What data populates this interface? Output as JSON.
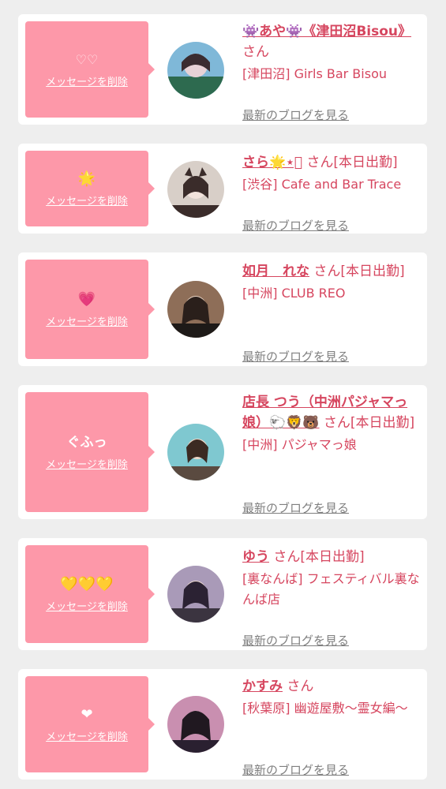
{
  "delete_label": "メッセージを削除",
  "blog_label": "最新のブログを見る",
  "entries": [
    {
      "message": "♡♡",
      "name": "👾あや👾《津田沼Bisou》",
      "san": "さん",
      "status": "",
      "shop": "[津田沼] Girls Bar Bisou",
      "avatar_colors": [
        "#7fb8d8",
        "#e7d2d6",
        "#2d6a4f"
      ]
    },
    {
      "message": "🌟",
      "name": "さら🌟⋆͛",
      "san": "さん",
      "status": "[本日出勤]",
      "shop": "[渋谷] Cafe and Bar Trace",
      "avatar_colors": [
        "#d8cfc8",
        "#f2e3dc",
        "#3a2c2a"
      ]
    },
    {
      "message": "💗",
      "name": "如月　れな",
      "san": "さん",
      "status": "[本日出勤]",
      "shop": "[中洲] CLUB REO",
      "avatar_colors": [
        "#8e6e58",
        "#e8d3c3",
        "#2a1f1b"
      ]
    },
    {
      "message": "ぐふっ",
      "name": "店長 つう（中洲パジャマっ娘）🐑🦁🐻",
      "san": "さん",
      "status": "[本日出勤]",
      "shop": "[中洲] パジャマっ娘",
      "avatar_colors": [
        "#7fc8d0",
        "#f0d7c7",
        "#3b2a22"
      ]
    },
    {
      "message": "💛💛💛",
      "name": "ゆう",
      "san": "さん",
      "status": "[本日出勤]",
      "shop": "[裏なんば] フェスティバル裏なんば店",
      "avatar_colors": [
        "#a99ab8",
        "#f1ddd4",
        "#2b2233"
      ]
    },
    {
      "message": "❤",
      "name": "かすみ",
      "san": "さん",
      "status": "",
      "shop": "[秋葉原] 幽遊屋敷〜霊女編〜",
      "avatar_colors": [
        "#c98fb0",
        "#f3e0e3",
        "#201820"
      ]
    }
  ]
}
